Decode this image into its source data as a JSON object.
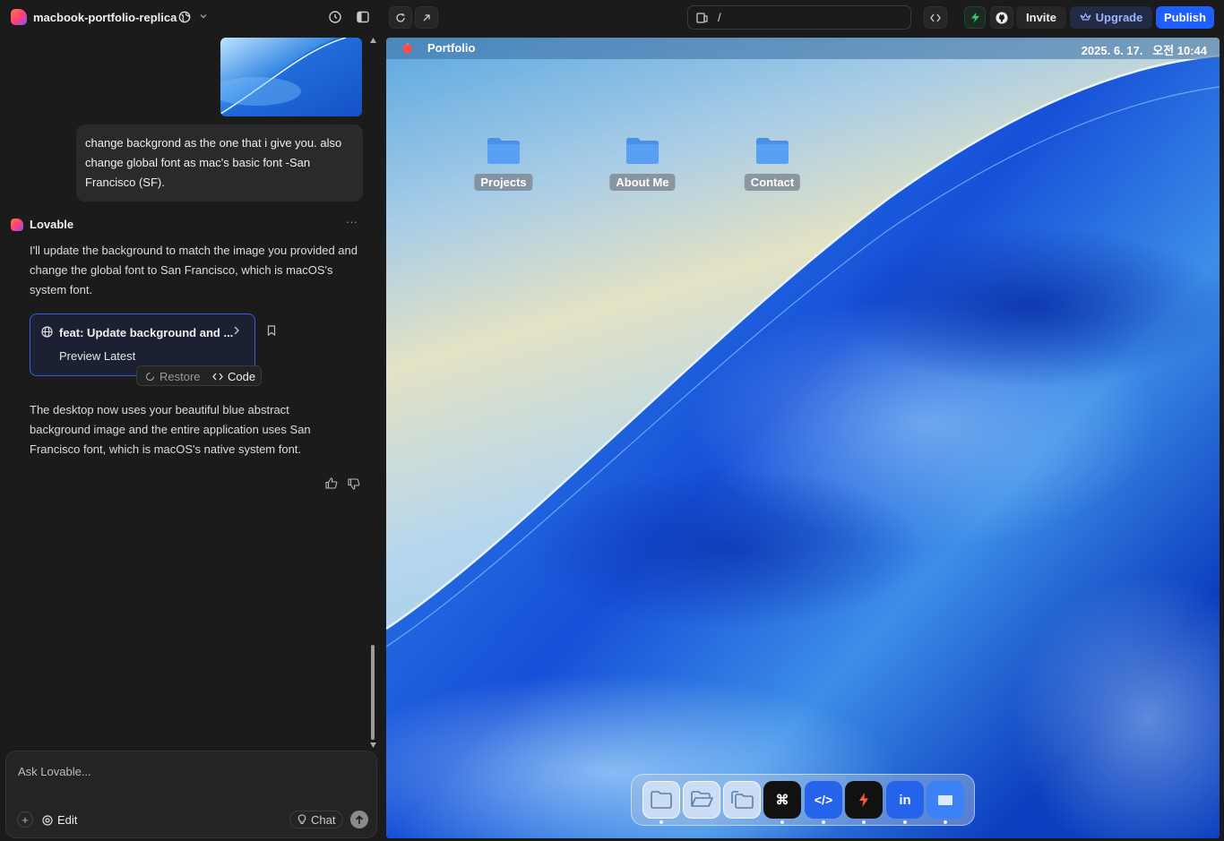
{
  "topbar": {
    "project_name": "macbook-portfolio-replica",
    "url_path": "/",
    "invite_label": "Invite",
    "upgrade_label": "Upgrade",
    "publish_label": "Publish",
    "colors": {
      "publish_bg": "#1f5eff",
      "upgrade_bg": "#232a46",
      "upgrade_text": "#9bb4ff",
      "accent_green": "#2ecc71"
    }
  },
  "chat": {
    "user_message": "change backgrond as the one that i give you. also change global font as mac's basic font -San Francisco (SF).",
    "assistant_name": "Lovable",
    "assistant_reply_1": "I'll update the background to match the image you provided and change the global font to San Francisco, which is macOS's system font.",
    "commit_card": {
      "title": "feat: Update background and ...",
      "subtitle": "Preview Latest"
    },
    "restore_label": "Restore",
    "code_label": "Code",
    "assistant_reply_2": "The desktop now uses your beautiful blue abstract background image and the entire application uses San Francisco font, which is macOS's native system font.",
    "input_placeholder": "Ask Lovable...",
    "edit_label": "Edit",
    "chat_label": "Chat"
  },
  "preview": {
    "menubar_title": "Portfolio",
    "menubar_time": "2025. 6. 17.   오전 10:44",
    "folders": [
      "Projects",
      "About Me",
      "Contact"
    ],
    "dock_items": [
      {
        "name": "finder-folder",
        "glyph": ""
      },
      {
        "name": "open-folder",
        "glyph": ""
      },
      {
        "name": "stack-folder",
        "glyph": ""
      },
      {
        "name": "command",
        "glyph": "⌘"
      },
      {
        "name": "code",
        "glyph": "</>"
      },
      {
        "name": "bolt",
        "glyph": ""
      },
      {
        "name": "linkedin",
        "glyph": "in"
      },
      {
        "name": "window",
        "glyph": ""
      }
    ]
  }
}
